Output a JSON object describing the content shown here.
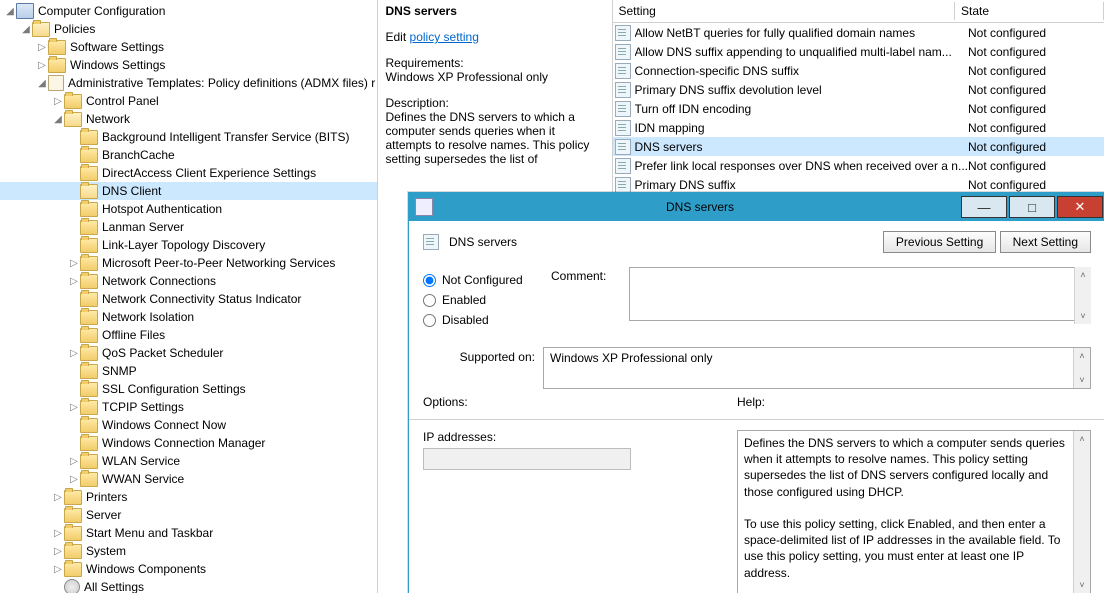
{
  "tree": {
    "root": "Computer Configuration",
    "policies": "Policies",
    "software": "Software Settings",
    "windows": "Windows Settings",
    "admx": "Administrative Templates: Policy definitions (ADMX files) r",
    "control_panel": "Control Panel",
    "network": "Network",
    "net_children": [
      "Background Intelligent Transfer Service (BITS)",
      "BranchCache",
      "DirectAccess Client Experience Settings",
      "DNS Client",
      "Hotspot Authentication",
      "Lanman Server",
      "Link-Layer Topology Discovery",
      "Microsoft Peer-to-Peer Networking Services",
      "Network Connections",
      "Network Connectivity Status Indicator",
      "Network Isolation",
      "Offline Files",
      "QoS Packet Scheduler",
      "SNMP",
      "SSL Configuration Settings",
      "TCPIP Settings",
      "Windows Connect Now",
      "Windows Connection Manager",
      "WLAN Service",
      "WWAN Service"
    ],
    "printers": "Printers",
    "server": "Server",
    "start_menu": "Start Menu and Taskbar",
    "system": "System",
    "win_comp": "Windows Components",
    "all_settings": "All Settings"
  },
  "desc": {
    "title": "DNS servers",
    "edit_prefix": "Edit ",
    "edit_link": "policy setting ",
    "req_h": "Requirements:",
    "req_v": "Windows XP Professional only",
    "desc_h": "Description:",
    "desc_v": "Defines the DNS servers to which a computer sends queries when it attempts to resolve names. This policy setting supersedes the list of"
  },
  "list": {
    "cols": {
      "setting": "Setting",
      "state": "State"
    },
    "rows": [
      {
        "name": "Allow NetBT queries for fully qualified domain names",
        "state": "Not configured"
      },
      {
        "name": "Allow DNS suffix appending to unqualified multi-label nam...",
        "state": "Not configured"
      },
      {
        "name": "Connection-specific DNS suffix",
        "state": "Not configured"
      },
      {
        "name": "Primary DNS suffix devolution level",
        "state": "Not configured"
      },
      {
        "name": "Turn off IDN encoding",
        "state": "Not configured"
      },
      {
        "name": "IDN mapping",
        "state": "Not configured"
      },
      {
        "name": "DNS servers",
        "state": "Not configured"
      },
      {
        "name": "Prefer link local responses over DNS when received over a n...",
        "state": "Not configured"
      },
      {
        "name": "Primary DNS suffix",
        "state": "Not configured"
      }
    ]
  },
  "dialog": {
    "title": "DNS servers",
    "header": "DNS servers",
    "prev": "Previous Setting",
    "next": "Next Setting",
    "r_not": "Not Configured",
    "r_en": "Enabled",
    "r_dis": "Disabled",
    "comment_lbl": "Comment:",
    "supported_lbl": "Supported on:",
    "supported_val": "Windows XP Professional only",
    "options_lbl": "Options:",
    "help_lbl": "Help:",
    "ip_lbl": "IP addresses:",
    "help_p1": "Defines the DNS servers to which a computer sends queries when it attempts to resolve names. This policy setting supersedes the list of DNS servers configured locally and those configured using DHCP.",
    "help_p2": "To use this policy setting, click Enabled, and then enter a space-delimited list of IP addresses in the available field. To use this policy setting, you must enter at least one IP address."
  }
}
